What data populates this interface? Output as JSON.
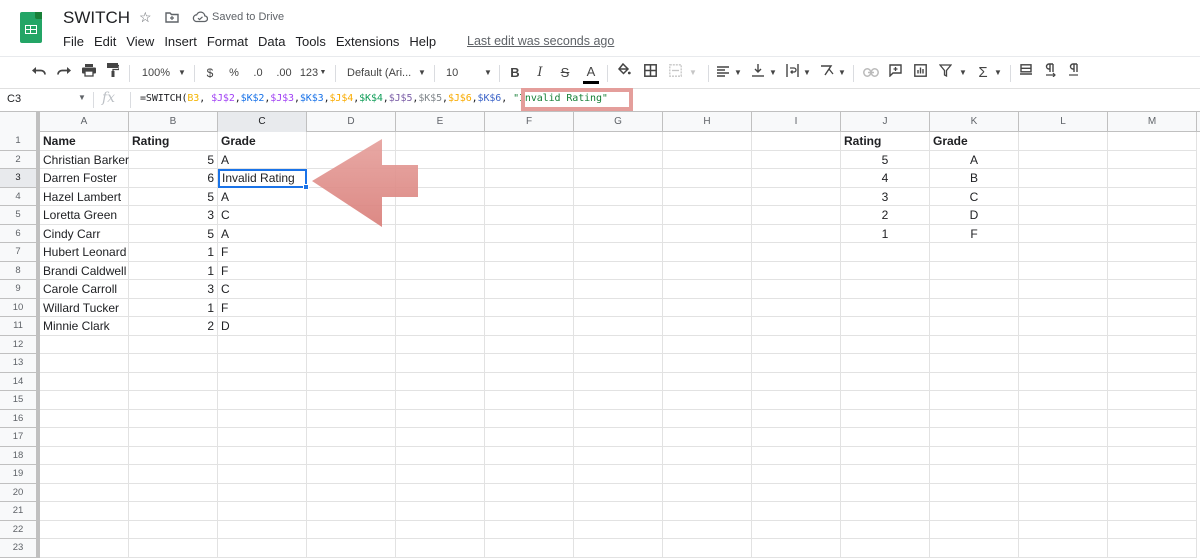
{
  "app": {
    "title": "SWITCH",
    "saved_status": "Saved to Drive",
    "last_edit": "Last edit was seconds ago",
    "menu": [
      "File",
      "Edit",
      "View",
      "Insert",
      "Format",
      "Data",
      "Tools",
      "Extensions",
      "Help"
    ]
  },
  "toolbar": {
    "zoom": "100%",
    "currency": "$",
    "percent": "%",
    "decrease_decimal": ".0",
    "increase_decimal": ".00",
    "more_formats": "123",
    "font": "Default (Ari...",
    "font_size": "10",
    "bold": "B",
    "italic": "I",
    "strikethrough": "S",
    "text_color": "A",
    "function": "Σ"
  },
  "formula_bar": {
    "name_box": "C3",
    "fx": "fx",
    "formula_parts": [
      {
        "text": "=SWITCH(",
        "color": "#202124"
      },
      {
        "text": "B3",
        "color": "#f4b400"
      },
      {
        "text": ", ",
        "color": "#202124"
      },
      {
        "text": "$J$2",
        "color": "#a142f4"
      },
      {
        "text": ",",
        "color": "#202124"
      },
      {
        "text": "$K$2",
        "color": "#1a73e8"
      },
      {
        "text": ",",
        "color": "#202124"
      },
      {
        "text": "$J$3",
        "color": "#a142f4"
      },
      {
        "text": ",",
        "color": "#202124"
      },
      {
        "text": "$K$3",
        "color": "#1a73e8"
      },
      {
        "text": ",",
        "color": "#202124"
      },
      {
        "text": "$J$4",
        "color": "#f9ab00"
      },
      {
        "text": ",",
        "color": "#202124"
      },
      {
        "text": "$K$4",
        "color": "#0f9d58"
      },
      {
        "text": ",",
        "color": "#202124"
      },
      {
        "text": "$J$5",
        "color": "#7b5ea7"
      },
      {
        "text": ",",
        "color": "#202124"
      },
      {
        "text": "$K$5",
        "color": "#80868b"
      },
      {
        "text": ",",
        "color": "#202124"
      },
      {
        "text": "$J$6",
        "color": "#f9ab00"
      },
      {
        "text": ",",
        "color": "#202124"
      },
      {
        "text": "$K$6",
        "color": "#3c64c8"
      },
      {
        "text": ", ",
        "color": "#202124"
      },
      {
        "text": "\"Invalid Rating\"",
        "color": "#188038"
      }
    ]
  },
  "sheet": {
    "columns": [
      "A",
      "B",
      "C",
      "D",
      "E",
      "F",
      "G",
      "H",
      "I",
      "J",
      "K",
      "L",
      "M"
    ],
    "selected_column": "C",
    "selected_row": 3,
    "row_count": 23,
    "main_table": {
      "headers": [
        "Name",
        "Rating",
        "Grade"
      ],
      "rows": [
        [
          "Christian Barker",
          "5",
          "A"
        ],
        [
          "Darren Foster",
          "6",
          "Invalid Rating"
        ],
        [
          "Hazel Lambert",
          "5",
          "A"
        ],
        [
          "Loretta Green",
          "3",
          "C"
        ],
        [
          "Cindy Carr",
          "5",
          "A"
        ],
        [
          "Hubert Leonard",
          "1",
          "F"
        ],
        [
          "Brandi Caldwell",
          "1",
          "F"
        ],
        [
          "Carole Carroll",
          "3",
          "C"
        ],
        [
          "Willard Tucker",
          "1",
          "F"
        ],
        [
          "Minnie Clark",
          "2",
          "D"
        ]
      ]
    },
    "lookup_table": {
      "headers": [
        "Rating",
        "Grade"
      ],
      "rows": [
        [
          "5",
          "A"
        ],
        [
          "4",
          "B"
        ],
        [
          "3",
          "C"
        ],
        [
          "2",
          "D"
        ],
        [
          "1",
          "F"
        ]
      ]
    }
  },
  "annotation": {
    "arrow_color": "#e08a86",
    "highlight_color": "#e49e9b"
  }
}
